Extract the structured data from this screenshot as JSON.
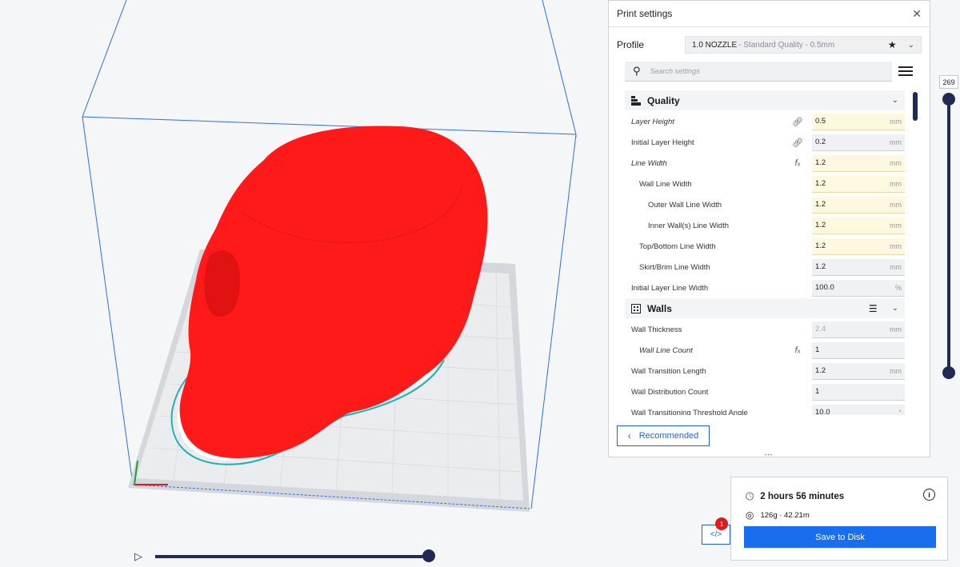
{
  "panel": {
    "title": "Print settings",
    "close_icon": "close-icon",
    "profile_label": "Profile",
    "profile_name": "1.0 NOZZLE",
    "profile_sub": " - Standard Quality - 0.5mm",
    "search_placeholder": "Search settings",
    "recommended_label": "Recommended"
  },
  "sections": {
    "quality": {
      "label": "Quality",
      "rows": [
        {
          "name": "Layer Height",
          "value": "0.5",
          "unit": "mm"
        },
        {
          "name": "Initial Layer Height",
          "value": "0.2",
          "unit": "mm"
        },
        {
          "name": "Line Width",
          "value": "1.2",
          "unit": "mm"
        },
        {
          "name": "Wall Line Width",
          "value": "1.2",
          "unit": "mm"
        },
        {
          "name": "Outer Wall Line Width",
          "value": "1.2",
          "unit": "mm"
        },
        {
          "name": "Inner Wall(s) Line Width",
          "value": "1.2",
          "unit": "mm"
        },
        {
          "name": "Top/Bottom Line Width",
          "value": "1.2",
          "unit": "mm"
        },
        {
          "name": "Skirt/Brim Line Width",
          "value": "1.2",
          "unit": "mm"
        },
        {
          "name": "Initial Layer Line Width",
          "value": "100.0",
          "unit": "%"
        }
      ]
    },
    "walls": {
      "label": "Walls",
      "rows": [
        {
          "name": "Wall Thickness",
          "value": "2.4",
          "unit": "mm"
        },
        {
          "name": "Wall Line Count",
          "value": "1",
          "unit": ""
        },
        {
          "name": "Wall Transition Length",
          "value": "1.2",
          "unit": "mm"
        },
        {
          "name": "Wall Distribution Count",
          "value": "1",
          "unit": ""
        },
        {
          "name": "Wall Transitioning Threshold Angle",
          "value": "10.0",
          "unit": "°"
        }
      ]
    }
  },
  "layer_slider": {
    "value": "269"
  },
  "output": {
    "time": "2 hours 56 minutes",
    "material": "126g · 42.21m",
    "save_label": "Save to Disk",
    "badge": "1",
    "gcode_icon": "</>"
  },
  "colors": {
    "model": "#ff1a1a",
    "accent": "#196ef0",
    "slider": "#1f2a55",
    "build_volume": "#2f6fdf"
  }
}
